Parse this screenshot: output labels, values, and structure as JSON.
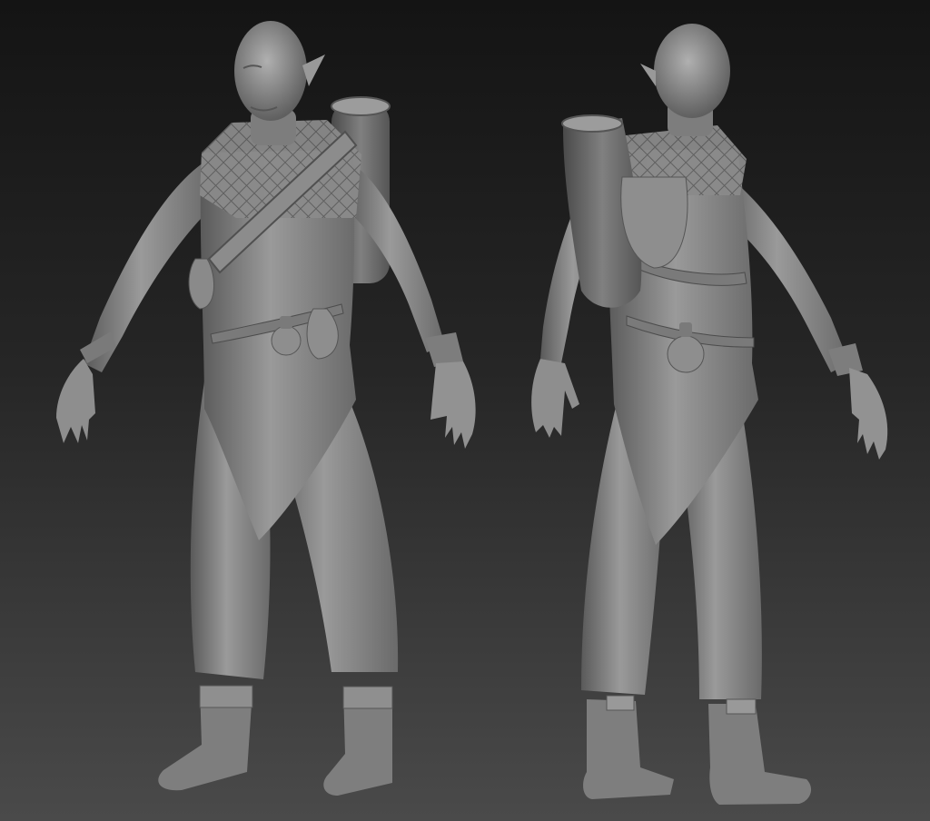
{
  "scene": {
    "description_free": true,
    "background_gradient": [
      "#141414",
      "#262626",
      "#4a4a4a"
    ],
    "material_color": "#8a8a8a",
    "material_shadow": "#4e4e4e",
    "material_highlight": "#b4b4b4"
  },
  "views": [
    {
      "view": "front-three-quarter"
    },
    {
      "view": "back-three-quarter"
    }
  ]
}
